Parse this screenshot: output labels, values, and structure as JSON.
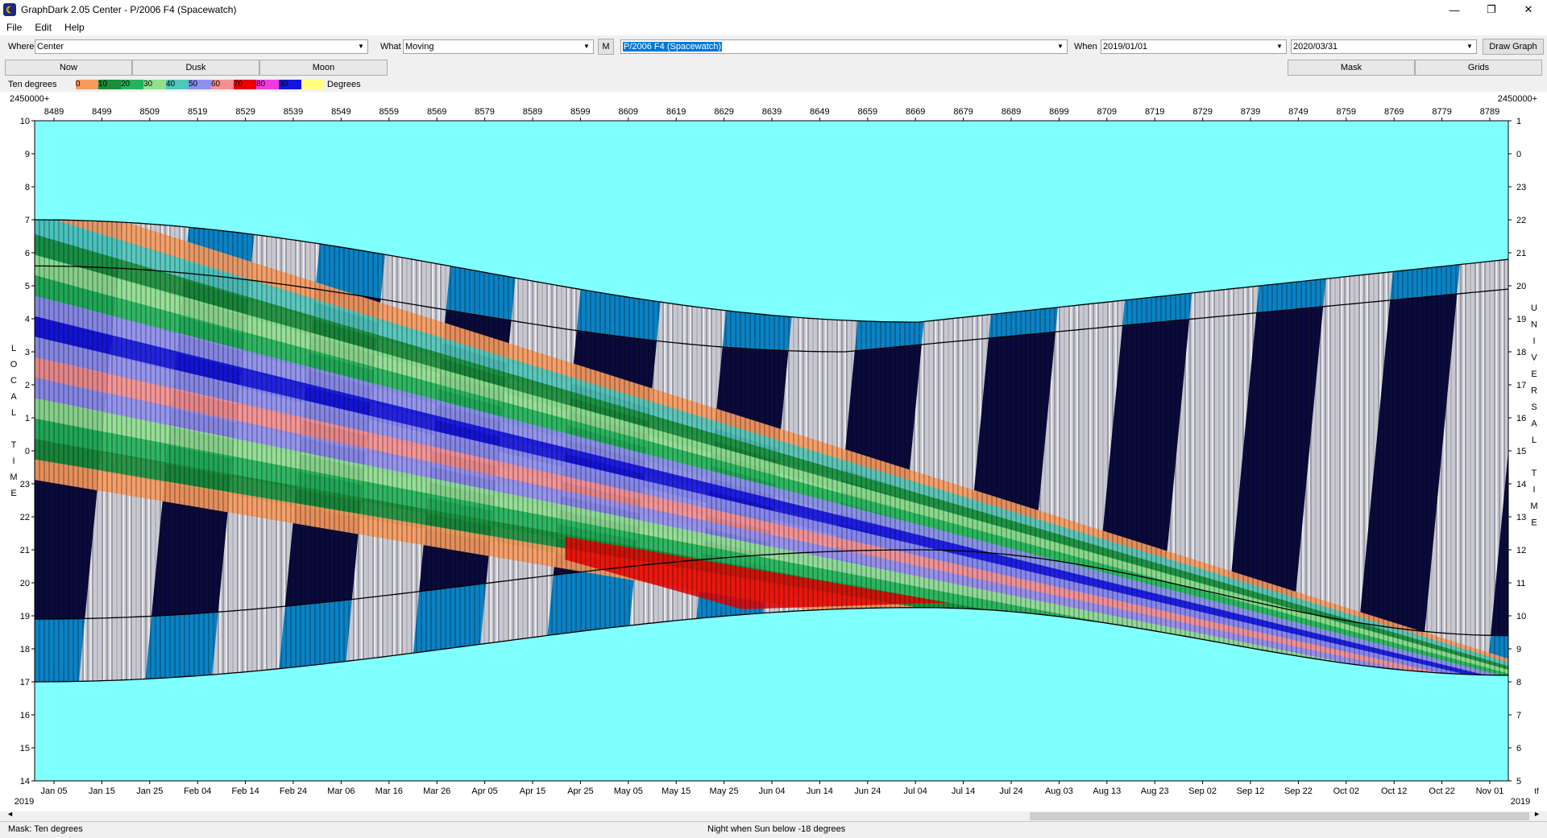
{
  "window": {
    "title": "GraphDark 2.05  Center  -  P/2006 F4 (Spacewatch)",
    "app_icon": "moon-icon",
    "minimize": "—",
    "restore": "❐",
    "close": "✕"
  },
  "menu": {
    "items": [
      "File",
      "Edit",
      "Help"
    ]
  },
  "toolbar": {
    "where_label": "Where",
    "where_value": "Center",
    "what_label": "What",
    "what_value": "Moving",
    "m_label": "M",
    "object_value": "P/2006 F4 (Spacewatch)",
    "when_label": "When",
    "start_date": "2019/01/01",
    "end_date": "2020/03/31",
    "draw_label": "Draw Graph"
  },
  "buttons": {
    "now": "Now",
    "dusk": "Dusk",
    "moon": "Moon",
    "mask": "Mask",
    "grids": "Grids"
  },
  "legend": {
    "prefix": "Ten degrees",
    "suffix": "Degrees",
    "entries": [
      {
        "label": "0",
        "color": "#f79a5e"
      },
      {
        "label": "10",
        "color": "#1a8e3a"
      },
      {
        "label": "20",
        "color": "#23b35a"
      },
      {
        "label": "30",
        "color": "#90e090"
      },
      {
        "label": "40",
        "color": "#4fc7bc"
      },
      {
        "label": "50",
        "color": "#8f8ff0"
      },
      {
        "label": "60",
        "color": "#f59090"
      },
      {
        "label": "70",
        "color": "#e80000"
      },
      {
        "label": "80",
        "color": "#f03cdc"
      },
      {
        "label": "90",
        "color": "#1515e0"
      },
      {
        "label": "",
        "color": "#ffff80"
      }
    ]
  },
  "graph": {
    "top_left_label": "2450000+",
    "top_right_label": "2450000+",
    "jd_ticks": [
      "8489",
      "8499",
      "8509",
      "8519",
      "8529",
      "8539",
      "8549",
      "8559",
      "8569",
      "8579",
      "8589",
      "8599",
      "8609",
      "8619",
      "8629",
      "8639",
      "8649",
      "8659",
      "8669",
      "8679",
      "8689",
      "8699",
      "8709",
      "8719",
      "8729",
      "8739",
      "8749",
      "8759",
      "8769",
      "8779",
      "8789"
    ],
    "date_ticks": [
      "Jan 05",
      "Jan 15",
      "Jan 25",
      "Feb 04",
      "Feb 14",
      "Feb 24",
      "Mar 06",
      "Mar 16",
      "Mar 26",
      "Apr 05",
      "Apr 15",
      "Apr 25",
      "May 05",
      "May 15",
      "May 25",
      "Jun 04",
      "Jun 14",
      "Jun 24",
      "Jul 04",
      "Jul 14",
      "Jul 24",
      "Aug 03",
      "Aug 13",
      "Aug 23",
      "Sep 02",
      "Sep 12",
      "Sep 22",
      "Oct 02",
      "Oct 12",
      "Oct 22",
      "Nov 01"
    ],
    "left_hours": [
      "10",
      "9",
      "8",
      "7",
      "6",
      "5",
      "4",
      "3",
      "2",
      "1",
      "0",
      "23",
      "22",
      "21",
      "20",
      "19",
      "18",
      "17",
      "16",
      "15",
      "14"
    ],
    "right_hours": [
      "1",
      "0",
      "23",
      "22",
      "21",
      "20",
      "19",
      "18",
      "17",
      "16",
      "15",
      "14",
      "13",
      "12",
      "11",
      "10",
      "9",
      "8",
      "7",
      "6",
      "5"
    ],
    "left_axis_title": "LOCAL TIME",
    "right_axis_title": "UNIVERSAL TIME",
    "year_left": "2019",
    "year_right": "2019",
    "bottom_right_extra": "tf",
    "colors": {
      "background": "#80ffff",
      "twilight": "#0a82c4",
      "night": "#0a0a3c",
      "moonlight": "#c8c8d2"
    }
  },
  "status": {
    "mask": "Mask:  Ten degrees",
    "night": "Night when Sun below -18 degrees"
  }
}
